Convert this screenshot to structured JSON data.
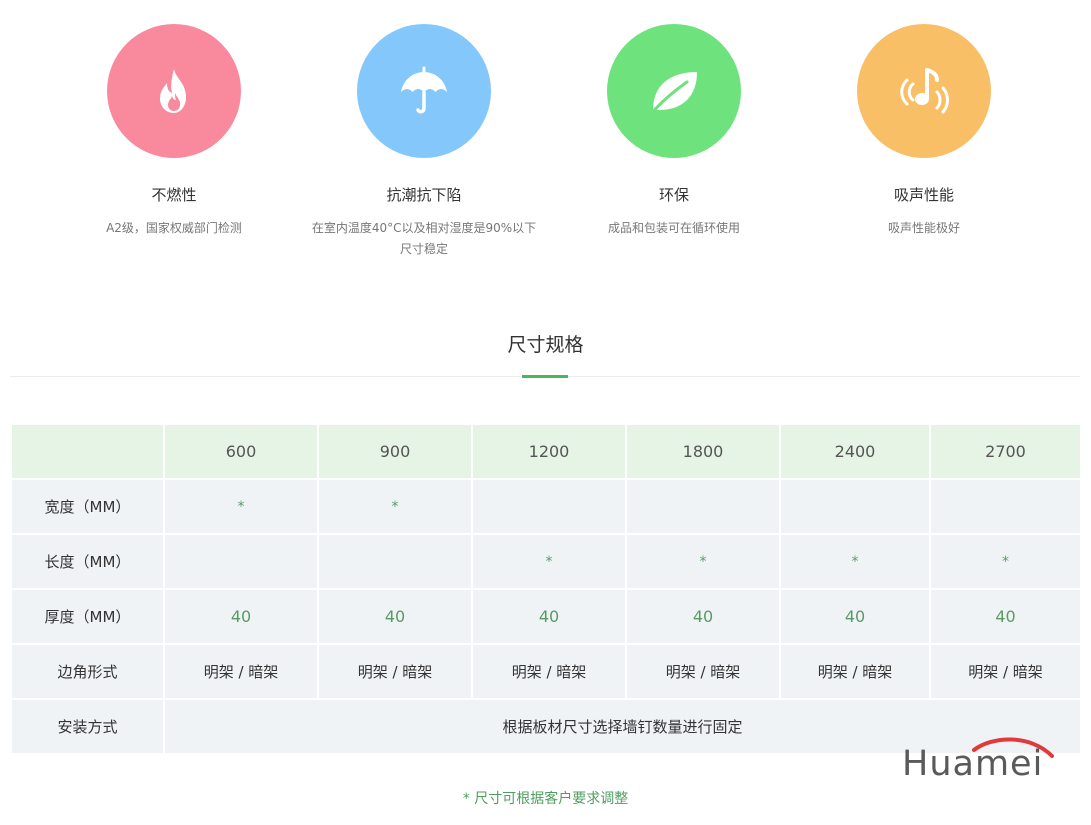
{
  "features": [
    {
      "title": "不燃性",
      "desc": [
        "A2级，国家权威部门检测"
      ],
      "color": "#f98a9d",
      "icon": "flame-icon"
    },
    {
      "title": "抗潮抗下陷",
      "desc": [
        "在室内温度40°C以及相对湿度是90%以下",
        "尺寸稳定"
      ],
      "color": "#84c8fb",
      "icon": "umbrella-icon"
    },
    {
      "title": "环保",
      "desc": [
        "成品和包装可在循环使用"
      ],
      "color": "#6ee27d",
      "icon": "leaf-icon"
    },
    {
      "title": "吸声性能",
      "desc": [
        "吸声性能极好"
      ],
      "color": "#f9bf66",
      "icon": "sound-note-icon"
    }
  ],
  "section_title": "尺寸规格",
  "table": {
    "columns": [
      "600",
      "900",
      "1200",
      "1800",
      "2400",
      "2700"
    ],
    "rows": [
      {
        "label": "宽度（MM）",
        "cells": [
          "*",
          "*",
          "",
          "",
          "",
          ""
        ]
      },
      {
        "label": "长度（MM）",
        "cells": [
          "",
          "",
          "*",
          "*",
          "*",
          "*"
        ]
      },
      {
        "label": "厚度（MM）",
        "cells": [
          "40",
          "40",
          "40",
          "40",
          "40",
          "40"
        ]
      },
      {
        "label": "边角形式",
        "cells": [
          "明架 / 暗架",
          "明架 / 暗架",
          "明架 / 暗架",
          "明架 / 暗架",
          "明架 / 暗架",
          "明架 / 暗架"
        ]
      },
      {
        "label": "安装方式",
        "merged": "根据板材尺寸选择墙钉数量进行固定"
      }
    ]
  },
  "note": "*  尺寸可根据客户要求调整",
  "logo": {
    "text": "Huamei",
    "arc_color": "#e03a3a"
  }
}
